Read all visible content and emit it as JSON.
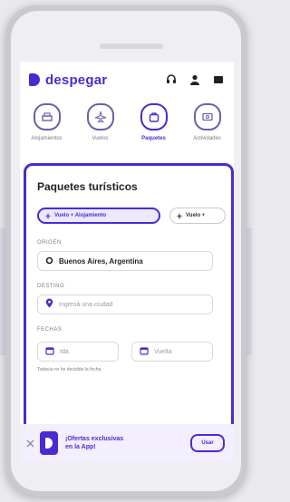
{
  "brand": {
    "name": "despegar",
    "accent": "#4b2bd1"
  },
  "nav": {
    "items": [
      {
        "label": "Alojamientos",
        "icon": "hotel-icon"
      },
      {
        "label": "Vuelos",
        "icon": "plane-icon"
      },
      {
        "label": "Paquetes",
        "icon": "suitcase-icon",
        "active": true
      },
      {
        "label": "Actividades",
        "icon": "ticket-icon"
      }
    ]
  },
  "search": {
    "title": "Paquetes turísticos",
    "chips": [
      {
        "label": "Vuelo + Alojamiento",
        "selected": true
      },
      {
        "label": "Vuelo +",
        "selected": false
      }
    ],
    "origin": {
      "label": "ORIGEN",
      "value": "Buenos Aires, Argentina"
    },
    "destination": {
      "label": "DESTINO",
      "placeholder": "Ingresá una ciudad"
    },
    "dates": {
      "label": "FECHAS",
      "start_placeholder": "Ida",
      "end_placeholder": "Vuelta"
    },
    "undecided_text": "Todavía no he decidido la fecha"
  },
  "banner": {
    "text_line1": "¡Ofertas exclusivas",
    "text_line2": "en la App!",
    "button_label": "Usar"
  }
}
